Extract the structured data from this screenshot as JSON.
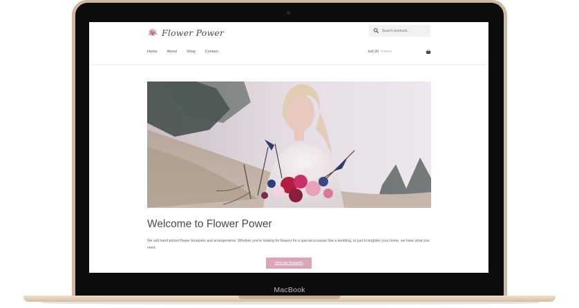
{
  "device": {
    "label": "MacBook"
  },
  "site": {
    "name": "Flower Power",
    "search_placeholder": "Search products…",
    "nav": [
      {
        "label": "Home"
      },
      {
        "label": "About"
      },
      {
        "label": "Shop"
      },
      {
        "label": "Contact"
      }
    ],
    "cart": {
      "amount": "kn0.00",
      "items": "0 items"
    }
  },
  "content": {
    "title": "Welcome to Flower Power",
    "description": "We sell hand-picked flower bouquets and arrangements. Whether you're looking for flowers for a special occasion like a wedding, or just to brighten your home, we have what you need.",
    "cta_label": "View our bouquets"
  },
  "colors": {
    "accent": "#dba5b5",
    "laptop_frame": "#cdb8a4"
  }
}
